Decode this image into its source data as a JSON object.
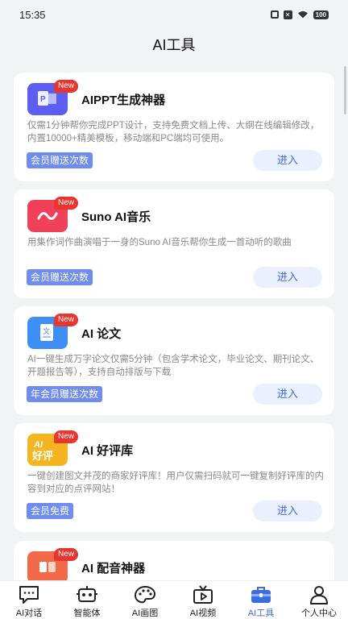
{
  "status_bar": {
    "time": "15:35",
    "battery": "100"
  },
  "header": {
    "title": "AI工具"
  },
  "new_badge": "New",
  "cards": [
    {
      "title": "AIPPT生成神器",
      "desc": "仅需1分钟帮你完成PPT设计，支持免费文档上传、大纲在线编辑修改，内置10000+精美模板，移动端和PC端均可使用。",
      "tag": "会员赠送次数",
      "button": "进入",
      "icon": "ppt-icon",
      "icon_color": "#5b5ef0"
    },
    {
      "title": "Suno AI音乐",
      "desc": "用集作词作曲演唱于一身的Suno AI音乐帮你生成一首动听的歌曲",
      "tag": "会员赠送次数",
      "button": "进入",
      "icon": "music-icon",
      "icon_color": "#f0405a"
    },
    {
      "title": "AI 论文",
      "desc": "AI一键生成万字论文仅需5分钟（包含学术论文，毕业论文、期刊论文、开题报告等），支持自动排版与下载",
      "tag": "年会员赠送次数",
      "button": "进入",
      "icon": "paper-icon",
      "icon_color": "#3e8ff5"
    },
    {
      "title": "AI 好评库",
      "desc": "一键创建图文并茂的商家好评库！用户仅需扫码就可一键复制好评库的内容到对应的点评网站！",
      "tag": "会员免费",
      "button": "进入",
      "icon": "review-icon",
      "icon_color": "#f5b520",
      "icon_text": "AI好评"
    },
    {
      "title": "AI 配音神器",
      "icon": "dubbing-icon",
      "icon_color": "#f06a4a"
    }
  ],
  "tabbar": [
    {
      "label": "AI对话",
      "icon": "chat-icon"
    },
    {
      "label": "智能体",
      "icon": "robot-icon"
    },
    {
      "label": "AI画图",
      "icon": "palette-icon"
    },
    {
      "label": "AI视频",
      "icon": "tv-icon"
    },
    {
      "label": "AI工具",
      "icon": "toolbox-icon",
      "active": true
    },
    {
      "label": "个人中心",
      "icon": "person-icon"
    }
  ],
  "colors": {
    "accent": "#3d6be0",
    "tag_bg": "#6f8cf0",
    "badge_red": "#e8352e",
    "page_bg": "#f2f3f5"
  }
}
